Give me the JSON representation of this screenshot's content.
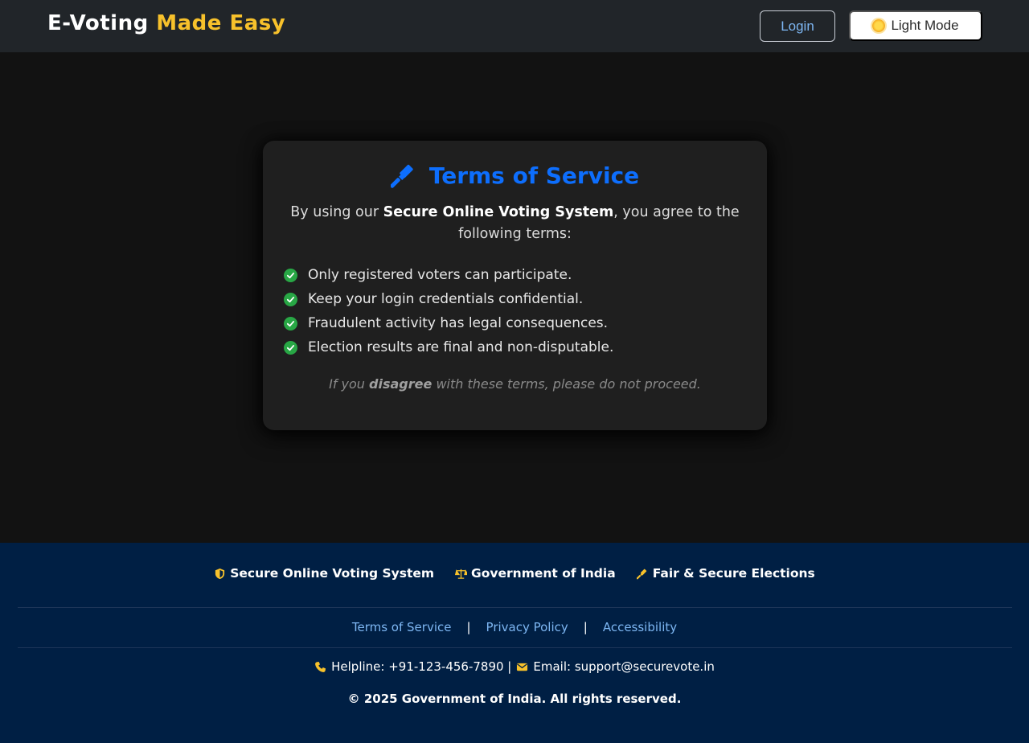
{
  "header": {
    "brand_main": "E-Voting",
    "brand_accent": "Made Easy",
    "login_label": "Login",
    "theme_toggle_label": "Light Mode"
  },
  "card": {
    "title": "Terms of Service",
    "intro_before": "By using our",
    "intro_strong": "Secure Online Voting System",
    "intro_after": ", you agree to the following terms:",
    "terms": [
      "Only registered voters can participate.",
      "Keep your login credentials confidential.",
      "Fraudulent activity has legal consequences.",
      "Election results are final and non-disputable."
    ],
    "disclaimer_before": "If you",
    "disclaimer_strong": "disagree",
    "disclaimer_after": "with these terms, please do not proceed."
  },
  "footer": {
    "badges": [
      "Secure Online Voting System",
      "Government of India",
      "Fair & Secure Elections"
    ],
    "links": [
      "Terms of Service",
      "Privacy Policy",
      "Accessibility"
    ],
    "link_separator": "|",
    "helpline": "Helpline: +91-123-456-7890 |",
    "email": "Email: support@securevote.in",
    "copyright": "© 2025 Government of India. All rights reserved."
  },
  "colors": {
    "accent_yellow": "#f7c12b",
    "primary_blue": "#0d6efd",
    "success_green": "#28a745",
    "footer_bg": "#001f44",
    "page_bg": "#121212"
  },
  "icons": {
    "title": "gavel-icon",
    "theme": "sun-icon",
    "term_check": "check-circle-icon",
    "badge_1": "shield-icon",
    "badge_2": "balance-scale-icon",
    "badge_3": "gavel-icon",
    "helpline": "phone-icon",
    "email": "envelope-icon"
  }
}
